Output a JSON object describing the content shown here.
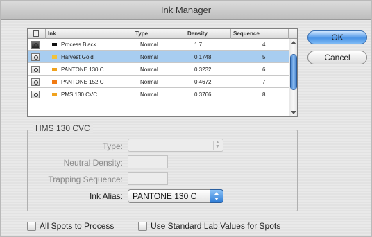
{
  "window": {
    "title": "Ink Manager"
  },
  "table": {
    "headers": [
      "Ink",
      "Type",
      "Density",
      "Sequence"
    ],
    "rows": [
      {
        "ink": "Process Black",
        "type": "Normal",
        "density": "1.7",
        "sequence": "4",
        "swatch": "#111111",
        "selected": false
      },
      {
        "ink": "Harvest Gold",
        "type": "Normal",
        "density": "0.1748",
        "sequence": "5",
        "swatch": "#f2c23a",
        "selected": true
      },
      {
        "ink": "PANTONE 130 C",
        "type": "Normal",
        "density": "0.3232",
        "sequence": "6",
        "swatch": "#f0a21e",
        "selected": false
      },
      {
        "ink": "PANTONE 152 C",
        "type": "Normal",
        "density": "0.4672",
        "sequence": "7",
        "swatch": "#f07a12",
        "selected": false
      },
      {
        "ink": "PMS 130 CVC",
        "type": "Normal",
        "density": "0.3766",
        "sequence": "8",
        "swatch": "#f0a21e",
        "selected": false
      }
    ]
  },
  "buttons": {
    "ok": "OK",
    "cancel": "Cancel"
  },
  "details": {
    "group_title": "HMS 130 CVC",
    "type_label": "Type:",
    "neutral_density_label": "Neutral Density:",
    "trapping_sequence_label": "Trapping Sequence:",
    "ink_alias_label": "Ink Alias:",
    "ink_alias_value": "PANTONE 130 C"
  },
  "options": {
    "all_spots_to_process": "All Spots to Process",
    "use_standard_lab": "Use Standard Lab Values for Spots"
  },
  "colors": {
    "selection": "#a8cdf0",
    "accent": "#4b94e6"
  }
}
